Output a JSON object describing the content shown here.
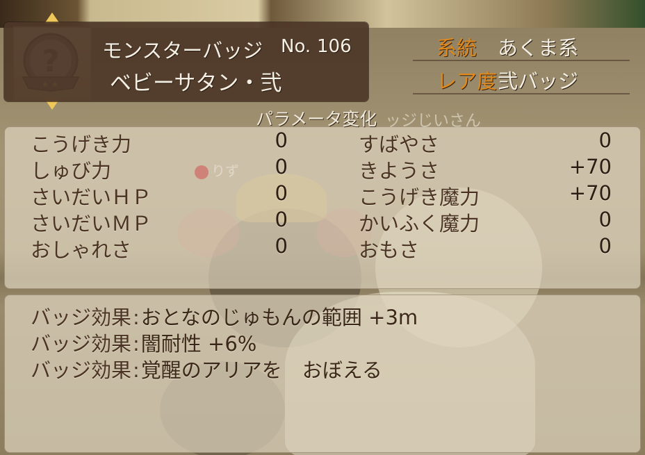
{
  "header": {
    "name": "モンスターバッジ",
    "number_label": "No.",
    "number_value": "106",
    "title": "ベビーサタン・弐"
  },
  "info": {
    "category_label": "系統",
    "category_value": "あくま系",
    "rarity_label": "レア度",
    "rarity_value": "弐バッジ"
  },
  "badge": {
    "icon": "question-medal-icon",
    "stars": 2
  },
  "section_title": "パラメータ変化",
  "background_text": {
    "npc_name": "ッジじいさん",
    "player_name": "りず"
  },
  "params": {
    "left": [
      {
        "label": "こうげき力",
        "value": "0"
      },
      {
        "label": "しゅび力",
        "value": "0"
      },
      {
        "label": "さいだいＨＰ",
        "value": "0"
      },
      {
        "label": "さいだいＭＰ",
        "value": "0"
      },
      {
        "label": "おしゃれさ",
        "value": "0"
      }
    ],
    "right": [
      {
        "label": "すばやさ",
        "value": "0"
      },
      {
        "label": "きようさ",
        "value": "+70"
      },
      {
        "label": "こうげき魔力",
        "value": "+70"
      },
      {
        "label": "かいふく魔力",
        "value": "0"
      },
      {
        "label": "おもさ",
        "value": "0"
      }
    ]
  },
  "effects": [
    {
      "label": "バッジ効果",
      "text": "おとなのじゅもんの範囲 +3m"
    },
    {
      "label": "バッジ効果",
      "text": "闇耐性 +6%"
    },
    {
      "label": "バッジ効果",
      "text": "覚醒のアリアを　おぼえる"
    }
  ],
  "colors": {
    "accent_label": "#e08a1e",
    "header_bg": "#4e3728",
    "panel_text": "#4b3424",
    "arrow": "#f0c85a"
  }
}
